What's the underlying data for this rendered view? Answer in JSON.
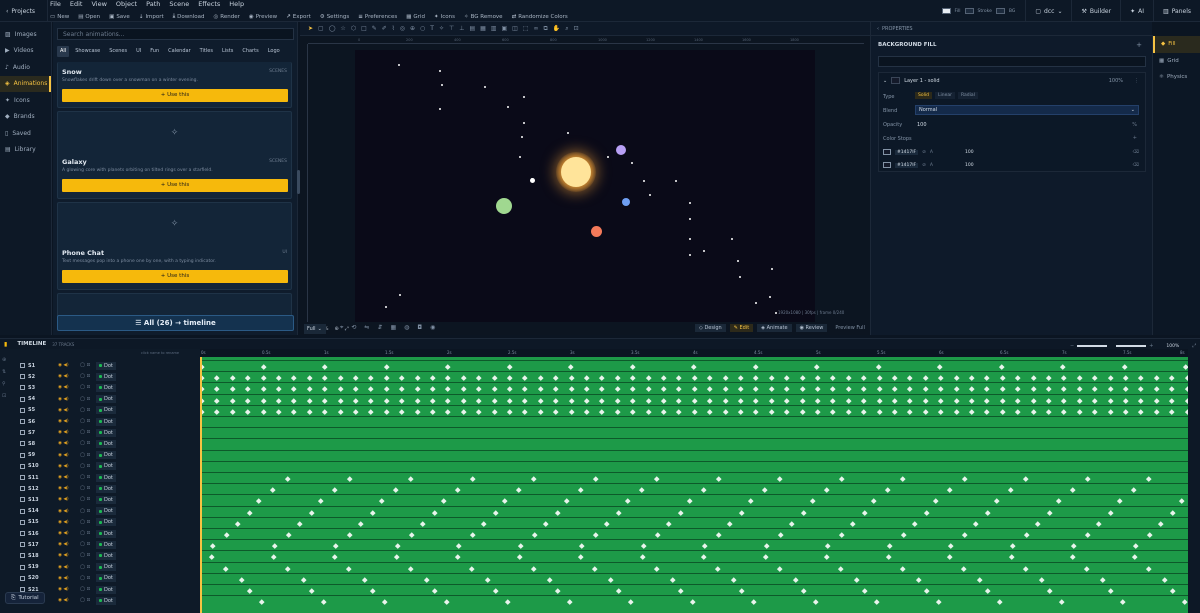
{
  "topbar": {
    "projects": "Projects",
    "menus": [
      "File",
      "Edit",
      "View",
      "Object",
      "Path",
      "Scene",
      "Effects",
      "Help"
    ],
    "tools": [
      "New",
      "Open",
      "Save",
      "Import",
      "Download",
      "Render",
      "Preview",
      "Export",
      "Settings",
      "Preferences",
      "Grid",
      "Icons",
      "BG Remove",
      "Randomize Colors"
    ],
    "fill_label": "Fill",
    "stroke_label": "Stroke",
    "bg_label": "BG",
    "workspace": "dcc",
    "builder": "Builder",
    "ai": "AI",
    "panels": "Panels"
  },
  "leftnav": [
    "Images",
    "Videos",
    "Audio",
    "Animations",
    "Icons",
    "Brands",
    "Saved",
    "Library"
  ],
  "leftnav_active": "Animations",
  "animpanel": {
    "search_placeholder": "Search animations...",
    "filters": [
      "All",
      "Showcase",
      "Scenes",
      "UI",
      "Fun",
      "Calendar",
      "Titles",
      "Lists",
      "Charts",
      "Logo"
    ],
    "active_filter": "All",
    "cards": [
      {
        "title": "Snow",
        "desc": "Snowflakes drift down over a snowman on a winter evening.",
        "tag": "SCENES",
        "btn": "+ Use this"
      },
      {
        "title": "Galaxy",
        "desc": "A glowing core with planets orbiting on tilted rings over a starfield.",
        "tag": "SCENES",
        "btn": "+ Use this"
      },
      {
        "title": "Phone Chat",
        "desc": "Text messages pop into a phone one by one, with a typing indicator.",
        "tag": "UI",
        "btn": "+ Use this"
      }
    ],
    "all_button": "All (26) → timeline"
  },
  "canvas": {
    "zoom": "100%",
    "fit": "Full",
    "info": "1920x1080  |  30fps  |  frame 0/240",
    "modes": [
      "Design",
      "Edit",
      "Animate",
      "Review"
    ],
    "active_mode": "Edit",
    "preview": "Preview Full",
    "ruler_ticks": [
      "0",
      "200",
      "400",
      "600",
      "800",
      "1000",
      "1200",
      "1400",
      "1600",
      "1800"
    ]
  },
  "properties": {
    "header": "PROPERTIES",
    "section": "BACKGROUND FILL",
    "layer": "Layer 1 - solid",
    "layer_opacity": "100%",
    "type_label": "Type",
    "types": [
      "Solid",
      "Linear",
      "Radial"
    ],
    "active_type": "Solid",
    "blend_label": "Blend",
    "blend_value": "Normal",
    "opacity_label": "Opacity",
    "opacity_value": "100",
    "opacity_unit": "%",
    "stops_label": "Color Stops",
    "stops": [
      {
        "color": "#1417IF",
        "alpha": "100"
      },
      {
        "color": "#1417IF",
        "alpha": "100"
      }
    ]
  },
  "props_side": [
    "Fill",
    "Grid",
    "Physics"
  ],
  "props_side_active": "Fill",
  "timeline": {
    "title": "TIMELINE",
    "sub": "37 TRACKS",
    "zoom": "100%",
    "ruler": [
      "0s",
      "0.5s",
      "1s",
      "1.5s",
      "2s",
      "2.5s",
      "3s",
      "3.5s",
      "4s",
      "4.5s",
      "5s",
      "5.5s",
      "6s",
      "6.5s",
      "7s",
      "7.5s",
      "8s"
    ],
    "hint": "click name to rename",
    "tracks": [
      "S1",
      "S2",
      "S3",
      "S4",
      "S5",
      "S6",
      "S7",
      "S8",
      "S9",
      "S10",
      "S11",
      "S12",
      "S13",
      "S14",
      "S15",
      "S16",
      "S17",
      "S18",
      "S19",
      "S20",
      "S21",
      "S22"
    ],
    "track_type": "Dot"
  },
  "tutorial": "Tutorial",
  "colors": {
    "accent": "#f6b90c",
    "track": "#1d9a48",
    "sun": "#ffe49a",
    "planet1": "#b8a0f5",
    "planet2": "#6f9ff2",
    "planet3": "#a0d890",
    "planet4": "#f47a5a"
  }
}
